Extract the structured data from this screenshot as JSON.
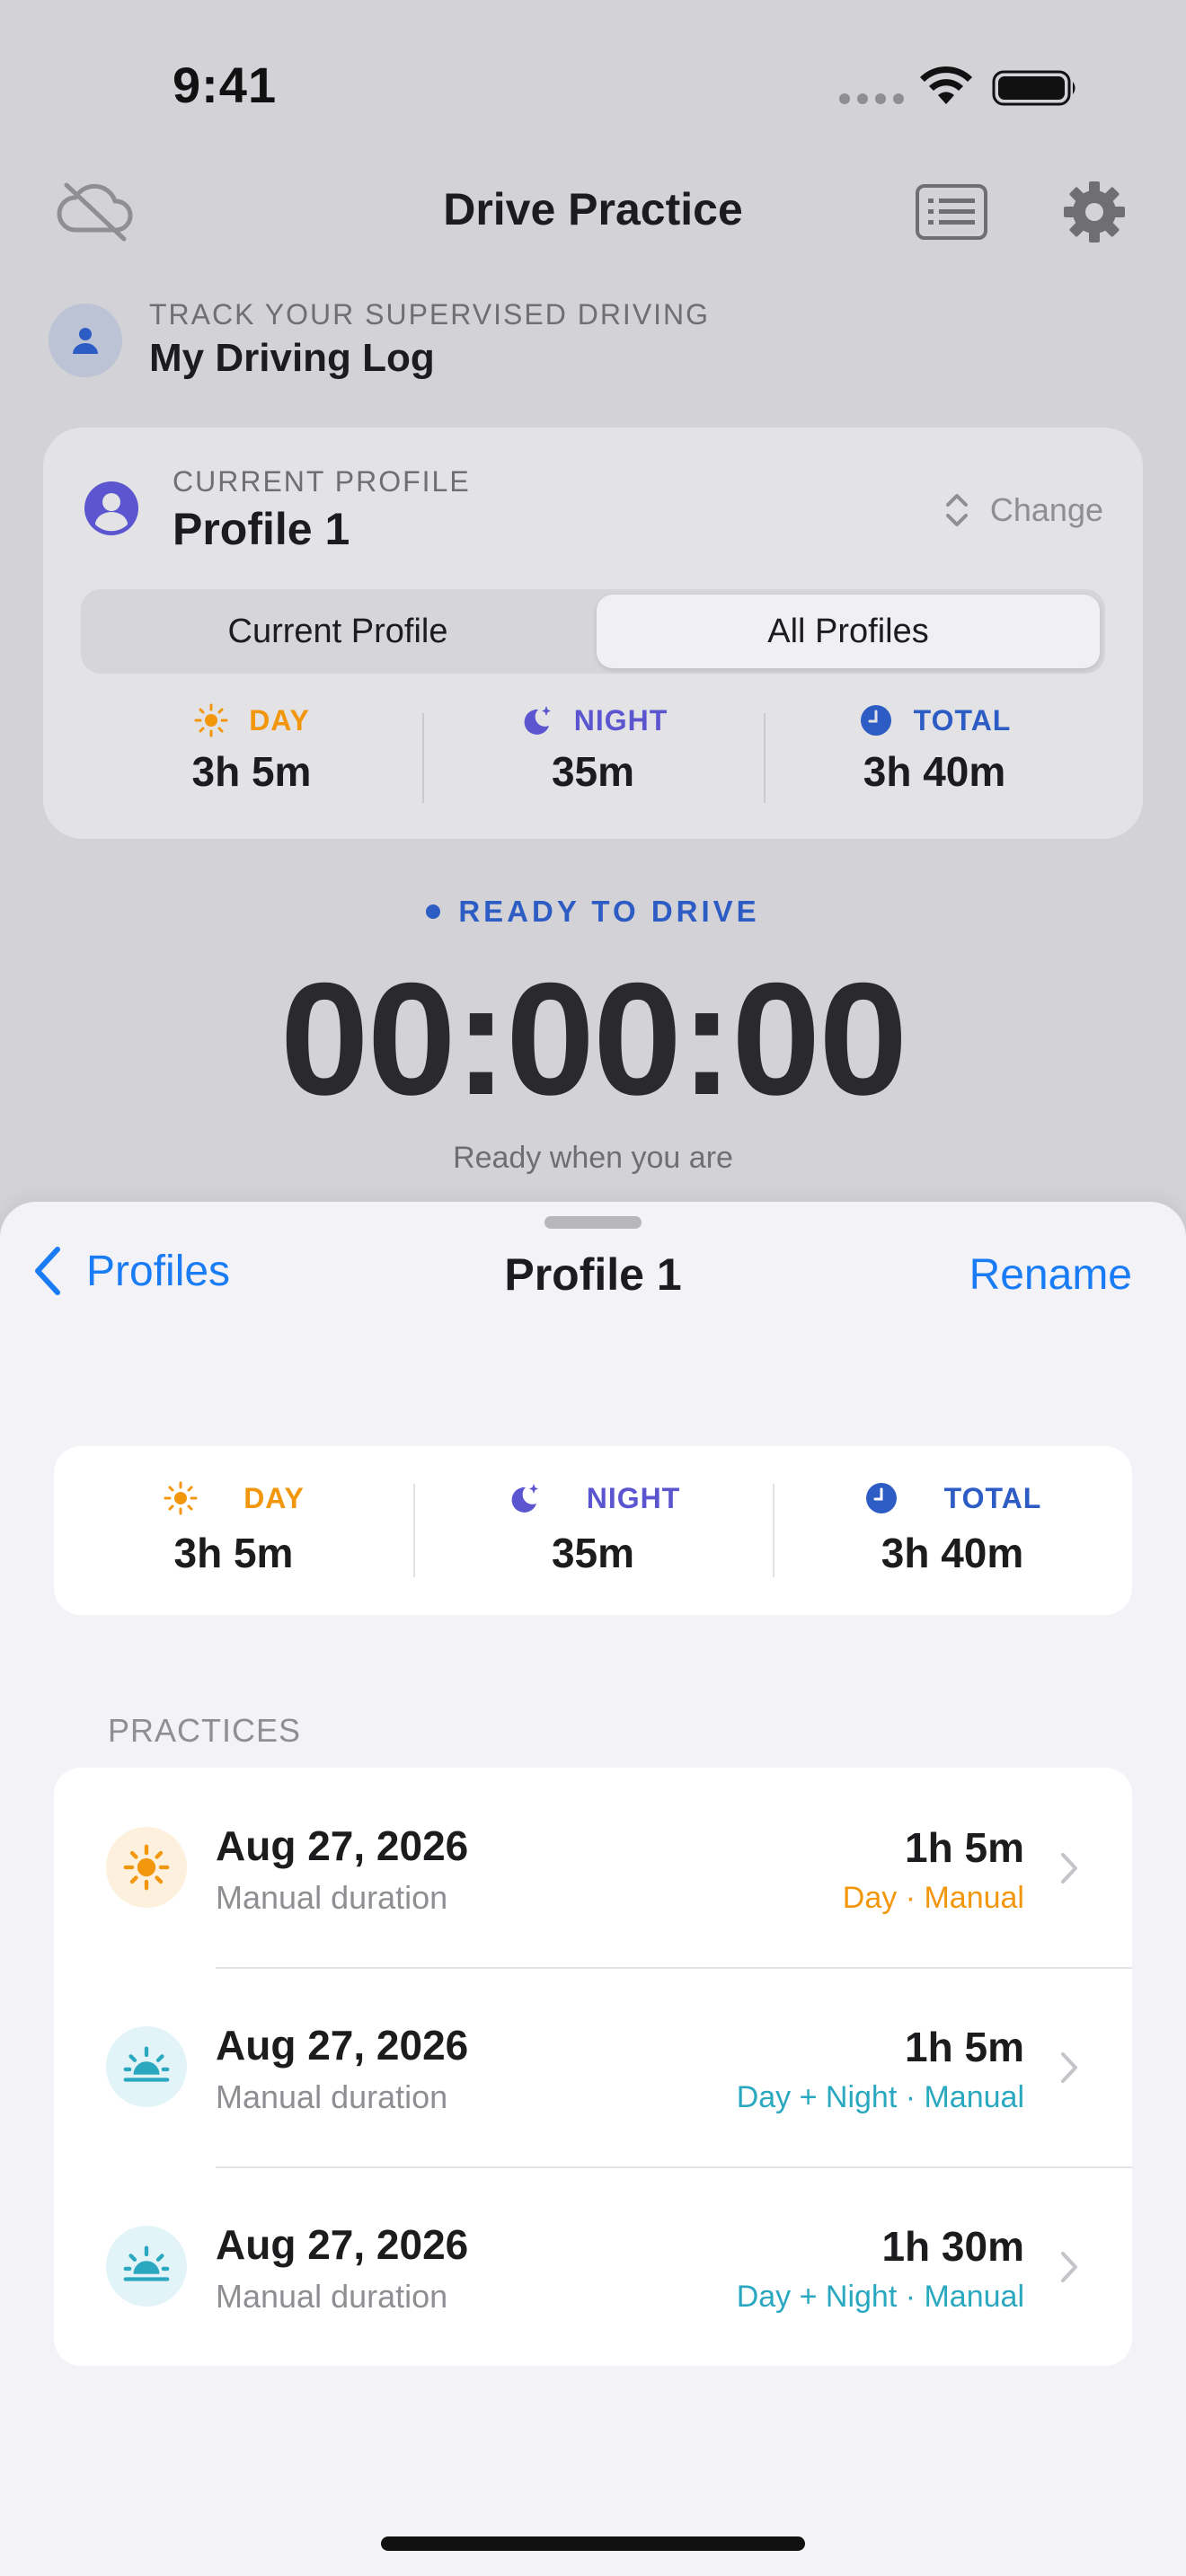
{
  "status_bar": {
    "time": "9:41"
  },
  "nav": {
    "title": "Drive Practice"
  },
  "header": {
    "eyebrow": "TRACK YOUR SUPERVISED DRIVING",
    "title": "My Driving Log"
  },
  "profile_card": {
    "eyebrow": "CURRENT PROFILE",
    "name": "Profile 1",
    "change_label": "Change",
    "segments": [
      "Current Profile",
      "All Profiles"
    ],
    "selected_segment": "All Profiles",
    "stats": {
      "day": {
        "label": "DAY",
        "value": "3h 5m"
      },
      "night": {
        "label": "NIGHT",
        "value": "35m"
      },
      "total": {
        "label": "TOTAL",
        "value": "3h 40m"
      }
    }
  },
  "timer": {
    "status": "READY TO DRIVE",
    "value": "00:00:00",
    "subtitle": "Ready when you are"
  },
  "sheet": {
    "back_label": "Profiles",
    "title": "Profile 1",
    "rename_label": "Rename",
    "stats": {
      "day": {
        "label": "DAY",
        "value": "3h 5m"
      },
      "night": {
        "label": "NIGHT",
        "value": "35m"
      },
      "total": {
        "label": "TOTAL",
        "value": "3h 40m"
      }
    },
    "section_header": "PRACTICES",
    "practices": [
      {
        "date": "Aug 27, 2026",
        "subtitle": "Manual duration",
        "duration": "1h 5m",
        "kind": "Day · Manual",
        "icon": "sun-icon"
      },
      {
        "date": "Aug 27, 2026",
        "subtitle": "Manual duration",
        "duration": "1h 5m",
        "kind": "Day + Night · Manual",
        "icon": "sunset-icon"
      },
      {
        "date": "Aug 27, 2026",
        "subtitle": "Manual duration",
        "duration": "1h 30m",
        "kind": "Day + Night · Manual",
        "icon": "sunset-icon"
      }
    ]
  },
  "colors": {
    "accent_blue": "#1a7cf5",
    "day_orange": "#f2960c",
    "night_purple": "#5b55d0",
    "total_blue": "#2d5cc4",
    "day_night_teal": "#2aa8c0"
  }
}
